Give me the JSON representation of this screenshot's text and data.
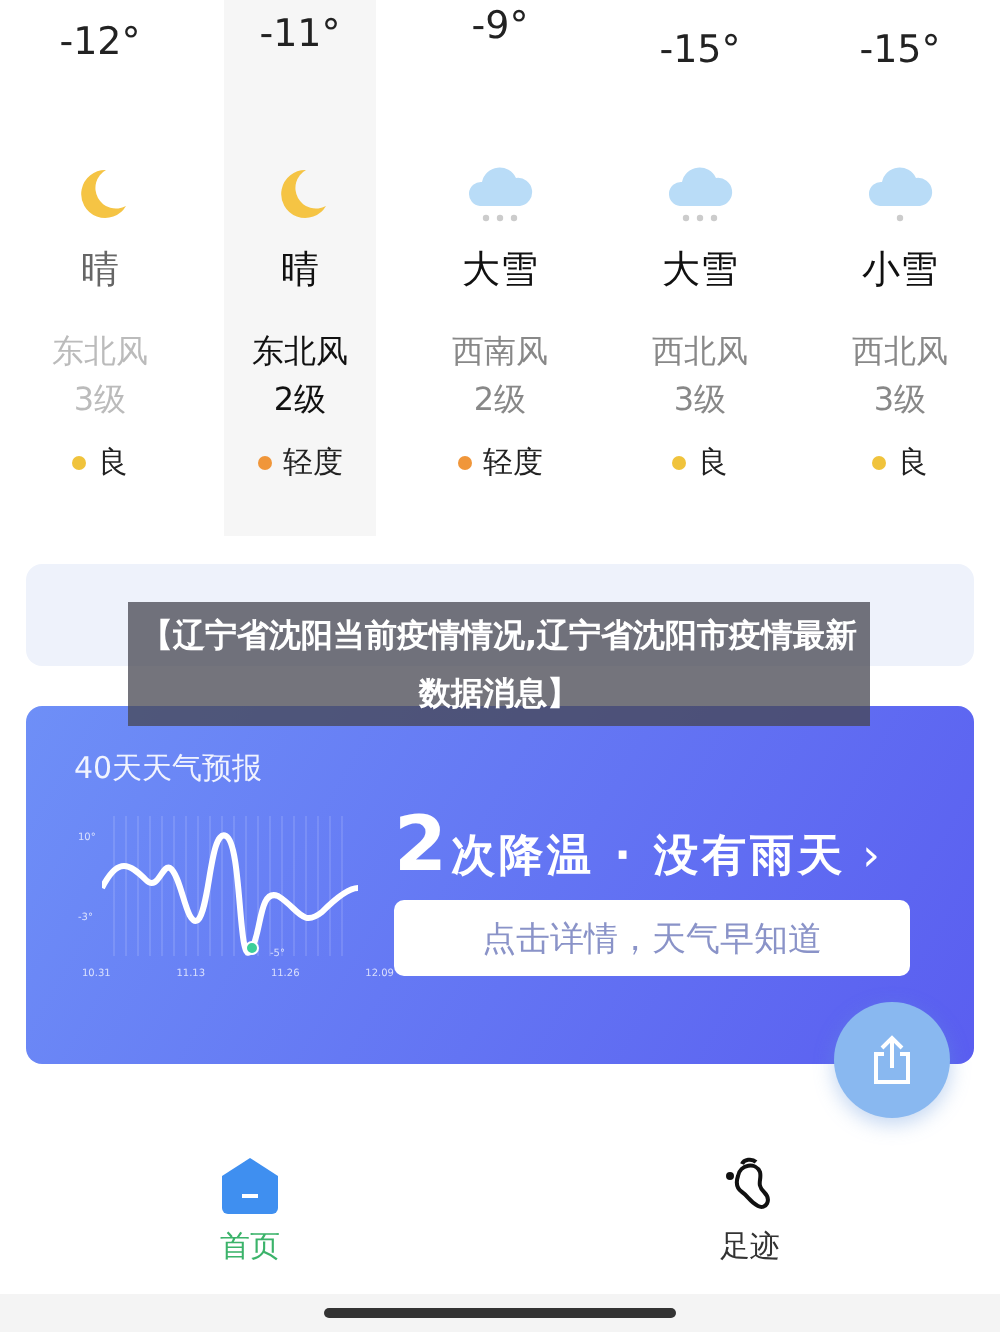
{
  "forecast": [
    {
      "temp": "-12°",
      "kind": "clear",
      "condition": "晴",
      "wind": "东北风",
      "wind_level": "3级",
      "air": "良",
      "color": "#f0c33c",
      "past": true,
      "selected": false
    },
    {
      "temp": "-11°",
      "kind": "clear",
      "condition": "晴",
      "wind": "东北风",
      "wind_level": "2级",
      "air": "轻度",
      "color": "#f0963a",
      "past": false,
      "selected": true
    },
    {
      "temp": "-9°",
      "kind": "heavy-snow",
      "condition": "大雪",
      "wind": "西南风",
      "wind_level": "2级",
      "air": "轻度",
      "color": "#f0963a",
      "past": false,
      "selected": false
    },
    {
      "temp": "-15°",
      "kind": "heavy-snow",
      "condition": "大雪",
      "wind": "西北风",
      "wind_level": "3级",
      "air": "良",
      "color": "#f0c33c",
      "past": false,
      "selected": false
    },
    {
      "temp": "-15°",
      "kind": "light-snow",
      "condition": "小雪",
      "wind": "西北风",
      "wind_level": "3级",
      "air": "良",
      "color": "#f0c33c",
      "past": false,
      "selected": false
    }
  ],
  "banner": {
    "text": "【辽宁省沈阳当前疫情情况,辽宁省沈阳市疫情最新数据消息】"
  },
  "trend_card": {
    "title": "40天天气预报",
    "y_labels": [
      "10°",
      "-3°",
      "-5°"
    ],
    "x_labels": [
      "10.31",
      "11.13",
      "11.26",
      "12.09"
    ],
    "headline_number": "2",
    "headline": "次降温 · 没有雨天",
    "chevron": "›",
    "button": "点击详情，天气早知道"
  },
  "tabs": [
    {
      "label": "首页",
      "selected": true
    },
    {
      "label": "足迹",
      "selected": false
    }
  ]
}
